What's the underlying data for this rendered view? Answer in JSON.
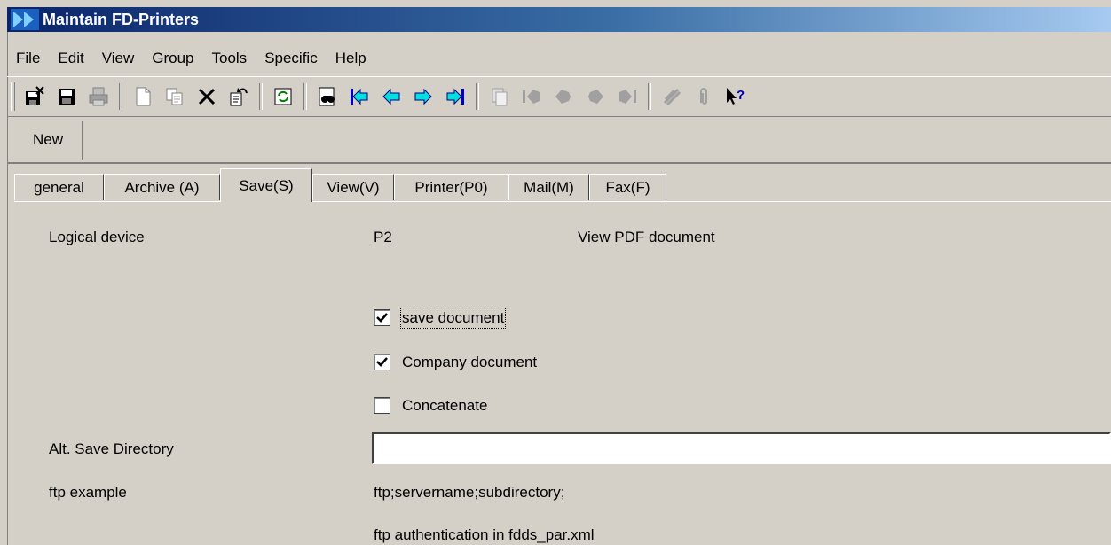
{
  "window": {
    "title": "Maintain FD-Printers"
  },
  "menu": [
    {
      "label": "File"
    },
    {
      "label": "Edit"
    },
    {
      "label": "View"
    },
    {
      "label": "Group"
    },
    {
      "label": "Tools"
    },
    {
      "label": "Specific"
    },
    {
      "label": "Help"
    }
  ],
  "toolbar": {
    "icons": [
      "save-close-icon",
      "save-icon",
      "print-icon",
      "new-document-icon",
      "copy-icon",
      "delete-icon",
      "undo-icon",
      "refresh-icon",
      "find-icon",
      "first-record-icon",
      "previous-record-icon",
      "next-record-icon",
      "last-record-icon",
      "document-icon",
      "back-icon",
      "forward-icon",
      "forward-icon-2",
      "last-icon",
      "notes-icon",
      "attachment-icon",
      "help-pointer-icon"
    ]
  },
  "toolbar2": {
    "new_label": "New"
  },
  "tabs": [
    "general",
    "Archive (A)",
    "Save(S)",
    "View(V)",
    "Printer(P0)",
    "Mail(M)",
    "Fax(F)"
  ],
  "active_tab": "Save(S)",
  "form": {
    "logical_device_label": "Logical device",
    "logical_device_value": "P2",
    "logical_device_desc": "View PDF document",
    "save_document": {
      "label": "save document",
      "checked": true
    },
    "company_document": {
      "label": "Company document",
      "checked": true
    },
    "concatenate": {
      "label": "Concatenate",
      "checked": false
    },
    "alt_save_dir_label": "Alt. Save Directory",
    "alt_save_dir_value": "",
    "ftp_example_label": "ftp example",
    "ftp_example_value": "ftp;servername;subdirectory;",
    "ftp_auth_note": "ftp authentication in fdds_par.xml"
  }
}
